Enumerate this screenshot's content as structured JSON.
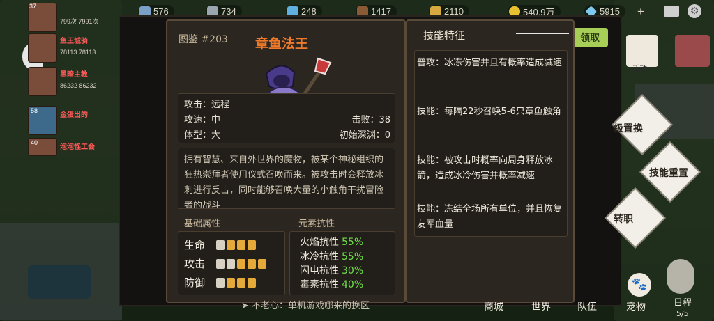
{
  "top_bar": {
    "resources": [
      {
        "value": "576",
        "icon": "gem-icon",
        "color": "#7aa0c8"
      },
      {
        "value": "734",
        "icon": "ore-icon",
        "color": "#9aa6b0"
      },
      {
        "value": "248",
        "icon": "crystal-icon",
        "color": "#5fb0e0"
      },
      {
        "value": "1417",
        "icon": "wood-icon",
        "color": "#8a5a34"
      },
      {
        "value": "2110",
        "icon": "scroll-icon",
        "color": "#d8a840"
      },
      {
        "value": "540.9万",
        "icon": "gold-coin-icon",
        "color": "#e8c030"
      },
      {
        "value": "5915",
        "icon": "diamond-icon",
        "color": "#7fc8f0"
      }
    ],
    "add_symbol": "+"
  },
  "side_list": [
    {
      "level": "37",
      "numbers": "799次 7991次"
    },
    {
      "name": "鱼王城骑",
      "numbers": "78113 78113"
    },
    {
      "name": "黑暗主教",
      "numbers": "86232 86232"
    },
    {
      "level": "58",
      "name": "金蛋出的"
    },
    {
      "level": "40",
      "name": "泡泡怪工会"
    }
  ],
  "monster": {
    "index_label": "图鉴 #203",
    "name": "章鱼法王",
    "stats": {
      "attack": "攻击：远程",
      "speed": "攻速：中",
      "size": "体型：大",
      "kills": "击败：38",
      "depth": "初始深渊：0"
    },
    "description": "拥有智慧、来自外世界的魔物，被某个神秘组织的狂热崇拜者使用仪式召唤而来。被攻击时会释放冰刺进行反击，同时能够召唤大量的小触角干扰冒险者的战斗",
    "basic_attr_title": "基础属性",
    "basic_attrs": [
      {
        "label": "生命",
        "white": 1,
        "gold": 3
      },
      {
        "label": "攻击",
        "white": 2,
        "gold": 3
      },
      {
        "label": "防御",
        "white": 1,
        "gold": 3
      }
    ],
    "element_title": "元素抗性",
    "resistances": [
      {
        "label": "火焰抗性",
        "value": "55%"
      },
      {
        "label": "冰冷抗性",
        "value": "55%"
      },
      {
        "label": "闪电抗性",
        "value": "30%"
      },
      {
        "label": "毒素抗性",
        "value": "40%"
      }
    ]
  },
  "skills": {
    "title": "技能特征",
    "items": [
      "普攻：冰冻伤害并且有概率造成减速",
      "技能：每隔22秒召唤5-6只章鱼触角",
      "技能：被攻击时概率向周身释放冰箭，造成冰冷伤害并概率减速",
      "技能：冻结全场所有单位，并且恢复友军血量"
    ]
  },
  "right_ui": {
    "claim_label": "领取",
    "activity_label": "活动",
    "swap_label": "级置换",
    "skill_reset_label": "技能重置",
    "job_change_label": "转职"
  },
  "bottom": {
    "chat": "不老心：单机游戏哪来的换区",
    "tabs": [
      "商城",
      "世界",
      "队伍",
      "宠物",
      "日程"
    ],
    "schedule_count": "5/5"
  }
}
